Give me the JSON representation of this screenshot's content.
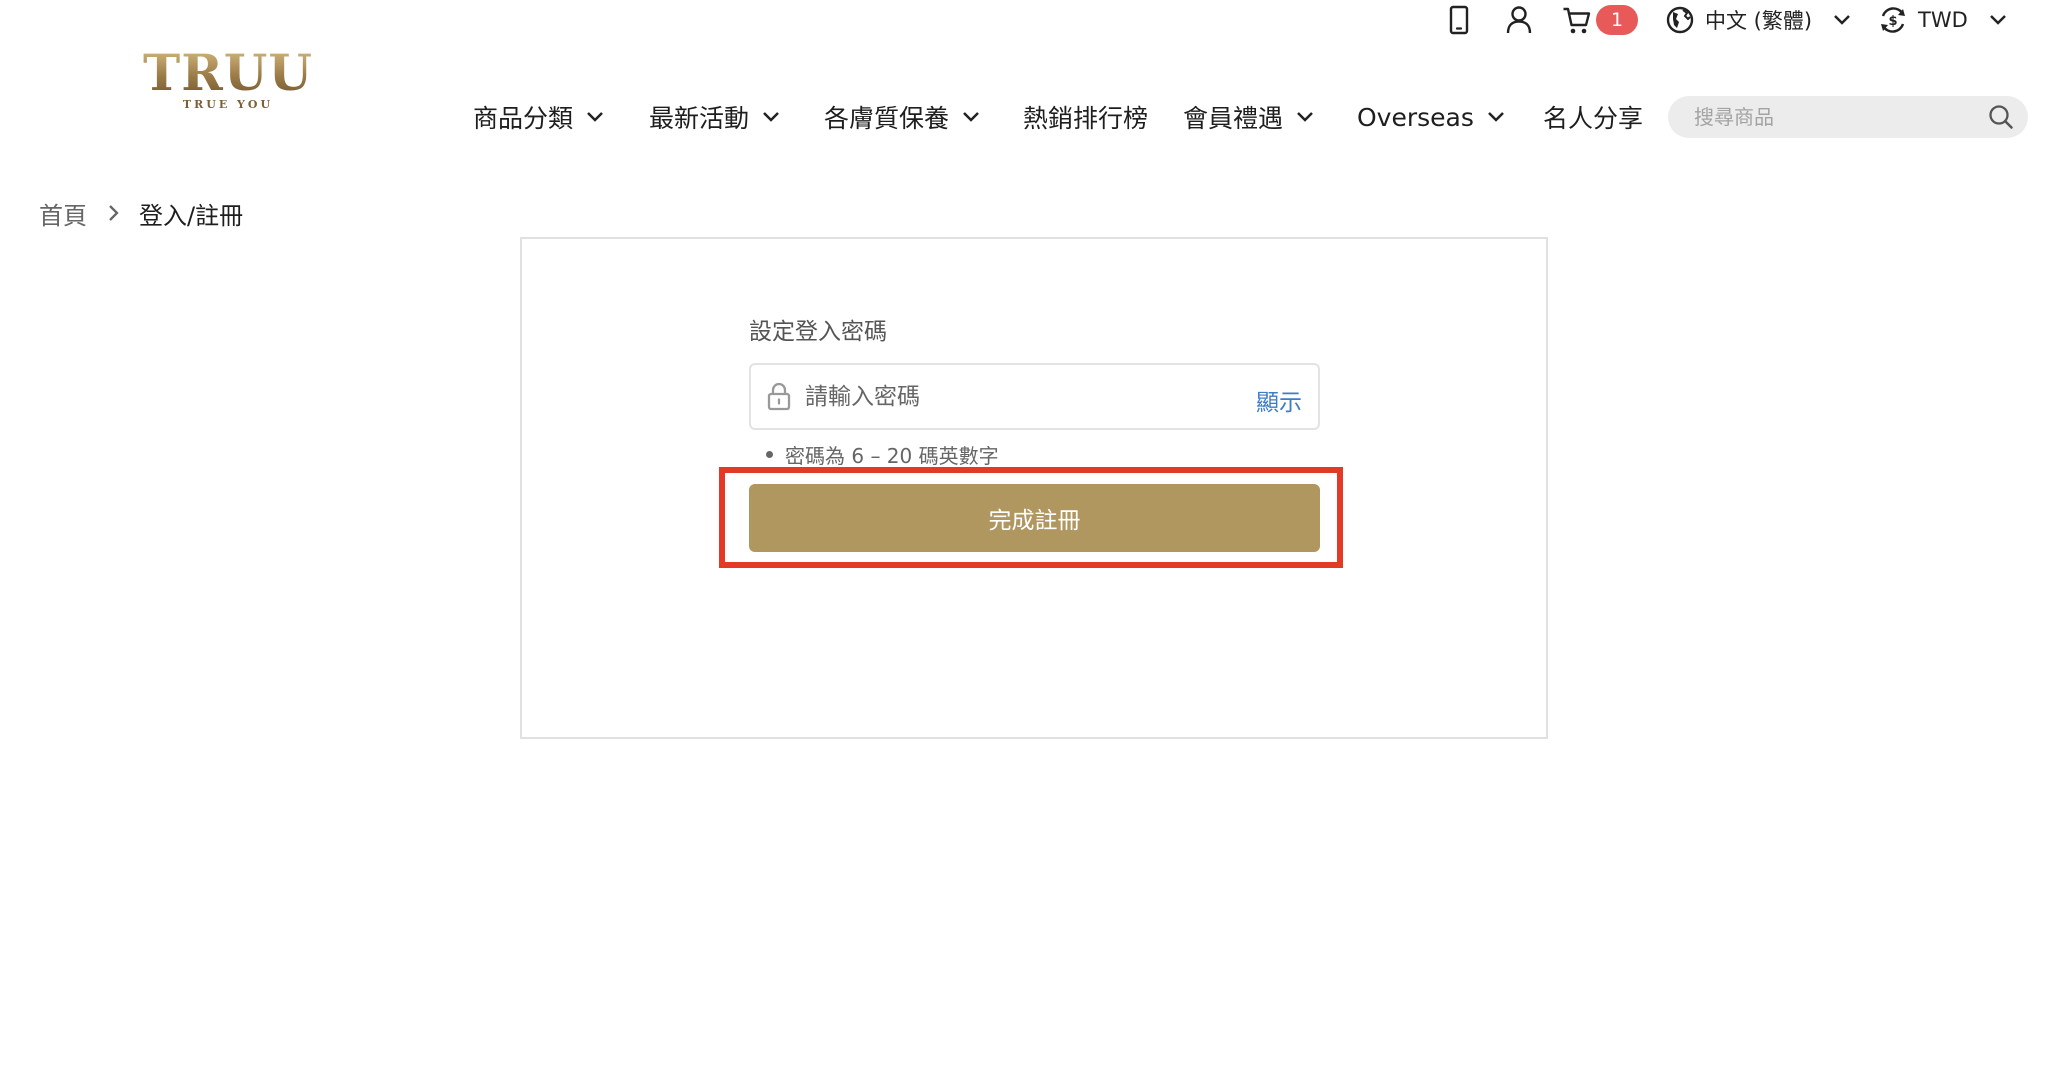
{
  "brand": {
    "logo_text": "TRUU",
    "logo_tagline": "TRUE YOU",
    "accent_color": "#b0965f"
  },
  "utility": {
    "mobile_icon": "mobile-phone-icon",
    "account_icon": "user-icon",
    "cart_icon": "cart-icon",
    "cart_count": "1",
    "language_label": "中文 (繁體)",
    "currency_label": "TWD"
  },
  "nav": {
    "items": [
      {
        "label": "商品分類",
        "dropdown": true
      },
      {
        "label": "最新活動",
        "dropdown": true
      },
      {
        "label": "各膚質保養",
        "dropdown": true
      },
      {
        "label": "熱銷排行榜",
        "dropdown": false
      },
      {
        "label": "會員禮遇",
        "dropdown": true
      },
      {
        "label": "Overseas",
        "dropdown": true
      },
      {
        "label": "名人分享",
        "dropdown": false
      }
    ],
    "search_placeholder": "搜尋商品"
  },
  "breadcrumb": {
    "home": "首頁",
    "current": "登入/註冊"
  },
  "form": {
    "label": "設定登入密碼",
    "password_placeholder": "請輸入密碼",
    "show_label": "顯示",
    "hint": "密碼為 6 – 20 碼英數字",
    "submit_label": "完成註冊"
  },
  "colors": {
    "cart_badge": "#e85a5a",
    "link": "#3e7cc5",
    "highlight": "#e23a26"
  }
}
